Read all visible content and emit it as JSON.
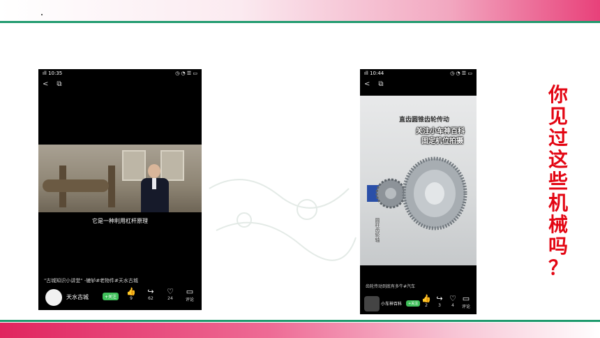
{
  "header": {
    "title": "你见过这些机械吗？"
  },
  "phone_left": {
    "status": {
      "time": "10:35",
      "signal": "ıll",
      "right": "◷ ◔ ☰ ▭"
    },
    "nav": {
      "back": "<",
      "share": "⧉"
    },
    "caption": "它是一种利用杠杆原理",
    "description": "\"古城知识小讲堂\" -辘轳#老物件#天水古城",
    "author": "天水古城",
    "follow_label": "+关注",
    "actions": [
      {
        "icon": "thumbs-up-icon",
        "glyph": "👍",
        "count": "9"
      },
      {
        "icon": "share-icon",
        "glyph": "↪",
        "count": "62"
      },
      {
        "icon": "heart-icon",
        "glyph": "♡",
        "count": "24"
      },
      {
        "icon": "comment-icon",
        "glyph": "▭",
        "count": "评论"
      }
    ]
  },
  "phone_right": {
    "status": {
      "time": "10:44",
      "signal": "ıll",
      "right": "◷ ◔ ☰ ▭"
    },
    "nav": {
      "back": "<",
      "share": "⧉"
    },
    "panel_title": "直齿圆锥齿轮传动",
    "overlay_line1": "关注小车神百科",
    "overlay_line2": "固定机位拍摄",
    "side_label": "圆柱齿轮轴",
    "caption": "齿轮传动到底有多牛#汽车",
    "author": "小车神百科",
    "follow_label": "+关注",
    "actions": [
      {
        "icon": "thumbs-up-icon",
        "glyph": "👍",
        "count": "2"
      },
      {
        "icon": "share-icon",
        "glyph": "↪",
        "count": "3"
      },
      {
        "icon": "heart-icon",
        "glyph": "♡",
        "count": "4"
      },
      {
        "icon": "comment-icon",
        "glyph": "▭",
        "count": "评论"
      }
    ]
  },
  "question": [
    "你",
    "见",
    "过",
    "这",
    "些",
    "机",
    "械",
    "吗",
    "？"
  ],
  "colors": {
    "accent_red": "#e30613",
    "top_pink": "#e8417a",
    "green_line": "#1f9a6e"
  }
}
